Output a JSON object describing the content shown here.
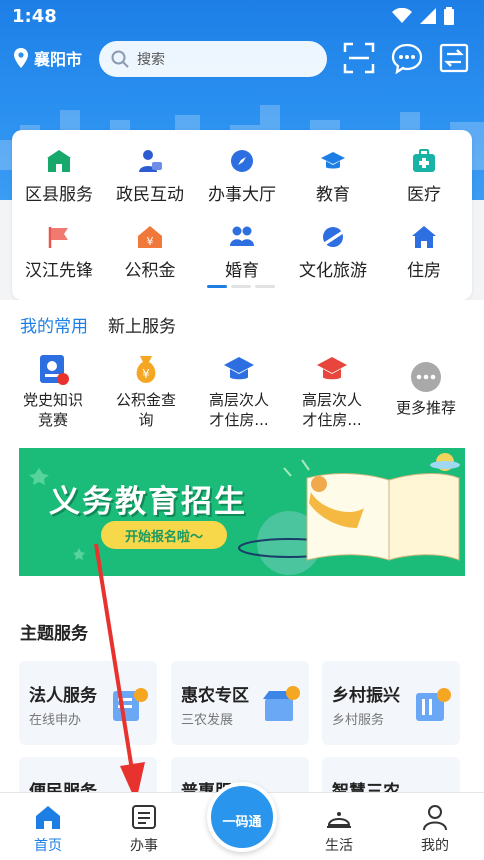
{
  "status_bar": {
    "time": "1:48"
  },
  "header": {
    "location": "襄阳市",
    "search_placeholder": "搜索"
  },
  "categories": [
    {
      "label": "区县服务",
      "icon": "city-gate-icon"
    },
    {
      "label": "政民互动",
      "icon": "people-chat-icon"
    },
    {
      "label": "办事大厅",
      "icon": "compass-icon"
    },
    {
      "label": "教育",
      "icon": "graduation-cap-icon"
    },
    {
      "label": "医疗",
      "icon": "medical-kit-icon"
    },
    {
      "label": "汉江先锋",
      "icon": "flag-icon"
    },
    {
      "label": "公积金",
      "icon": "house-fund-icon"
    },
    {
      "label": "婚育",
      "icon": "family-icon"
    },
    {
      "label": "文化旅游",
      "icon": "plane-globe-icon"
    },
    {
      "label": "住房",
      "icon": "house-icon"
    }
  ],
  "tabs": {
    "active": "我的常用",
    "other": "新上服务"
  },
  "favorites": [
    {
      "line1": "党史知识",
      "line2": "竞赛",
      "icon": "quiz-badge-icon"
    },
    {
      "line1": "公积金查",
      "line2": "询",
      "icon": "money-bag-icon"
    },
    {
      "line1": "高层次人",
      "line2": "才住房...",
      "icon": "graduation-cap-icon"
    },
    {
      "line1": "高层次人",
      "line2": "才住房...",
      "icon": "graduation-cap-red-icon"
    },
    {
      "line1": "更多推荐",
      "line2": "",
      "icon": "more-dots-icon"
    }
  ],
  "banner": {
    "title": "义务教育招生",
    "button": "开始报名啦～"
  },
  "theme": {
    "title": "主题服务",
    "cards": [
      {
        "name": "法人服务",
        "sub": "在线申办"
      },
      {
        "name": "惠农专区",
        "sub": "三农发展"
      },
      {
        "name": "乡村振兴",
        "sub": "乡村服务"
      },
      {
        "name": "便民服务",
        "sub": ""
      },
      {
        "name": "普惠服务",
        "sub": ""
      },
      {
        "name": "智慧三农",
        "sub": ""
      }
    ]
  },
  "bottom_nav": {
    "home": "首页",
    "affairs": "办事",
    "center": "一码通",
    "life": "生活",
    "mine": "我的"
  },
  "colors": {
    "primary": "#1d7fe6",
    "banner_green": "#1bbc7a",
    "annotation_red": "#e8322e"
  }
}
